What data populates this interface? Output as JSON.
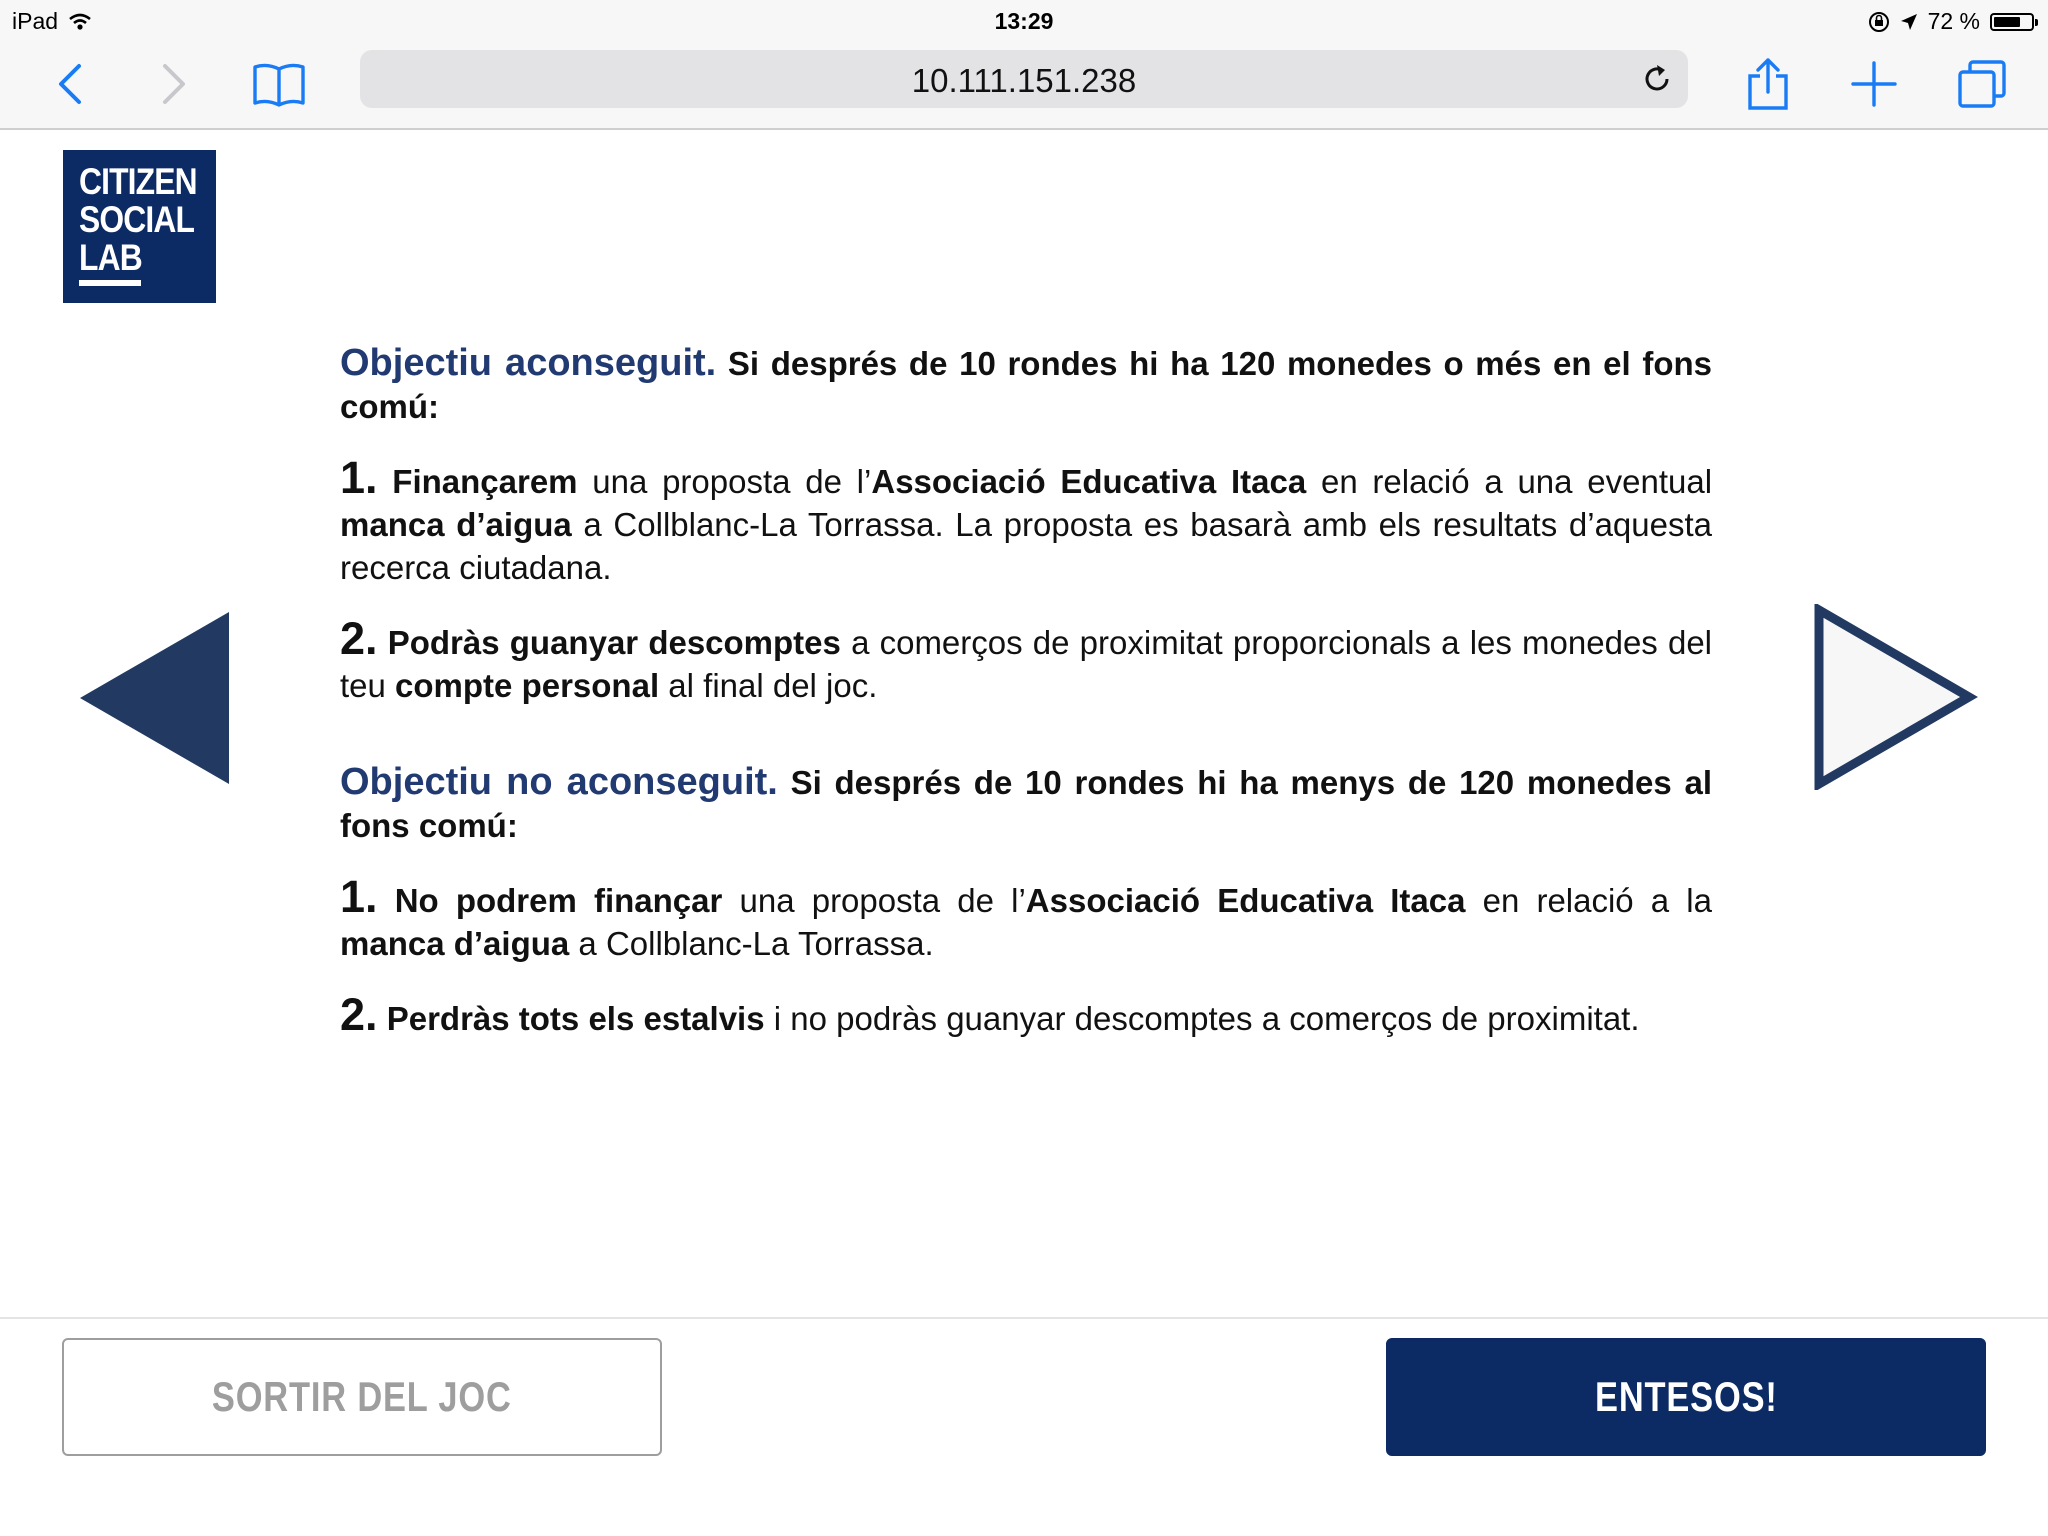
{
  "status_bar": {
    "device": "iPad",
    "time": "13:29",
    "battery_text": "72 %",
    "battery_level": 0.72,
    "icons": [
      "wifi-icon",
      "rotation-lock-icon",
      "location-arrow-icon",
      "battery-icon"
    ]
  },
  "browser": {
    "url": "10.111.151.238",
    "icons": [
      "back-icon",
      "forward-icon",
      "bookmarks-icon",
      "reload-icon",
      "share-icon",
      "new-tab-icon",
      "tabs-icon"
    ]
  },
  "logo": {
    "lines": [
      "CITIZEN",
      "SOCIAL",
      "LAB"
    ],
    "color": "#0c2a63"
  },
  "content": {
    "achieved": {
      "title": "Objectiu aconseguit.",
      "condition": " Si després de 10 rondes hi ha 120 monedes o més en el fons comú:",
      "item1": {
        "num": "1.",
        "t1": "Finançarem",
        "t2": " una proposta de l’",
        "t3": "Associació Educativa Itaca",
        "t4": " en relació a una eventual ",
        "t5": "manca d’aigua",
        "t6": " a Collblanc-La Torrassa. La proposta es basarà amb els resultats d’aquesta recerca ciutadana."
      },
      "item2": {
        "num": "2.",
        "t1": "Podràs guanyar descomptes",
        "t2": " a comerços de proximitat proporcionals a les monedes del teu ",
        "t3": "compte personal",
        "t4": " al final del joc."
      }
    },
    "not_achieved": {
      "title": "Objectiu no aconseguit.",
      "condition": " Si després de 10 rondes hi ha menys de 120 monedes al fons comú:",
      "item1": {
        "num": "1.",
        "t1": "No podrem finançar",
        "t2": " una proposta de l’",
        "t3": "Associació Educativa Itaca",
        "t4": " en relació a la ",
        "t5": "manca d’aigua",
        "t6": " a Collblanc-La Torrassa."
      },
      "item2": {
        "num": "2.",
        "t1": "Perdràs tots els estalvis",
        "t2": " i no podràs guanyar descomptes a comerços de proximitat."
      }
    }
  },
  "navigation": {
    "prev_icon": "triangle-left-filled-icon",
    "next_icon": "triangle-right-outline-icon"
  },
  "buttons": {
    "exit_label": "SORTIR DEL JOC",
    "ok_label": "ENTESOS!"
  },
  "colors": {
    "brand_navy": "#0c2a63",
    "heading_blue": "#223a72",
    "exit_gray": "#9e9e9e"
  }
}
